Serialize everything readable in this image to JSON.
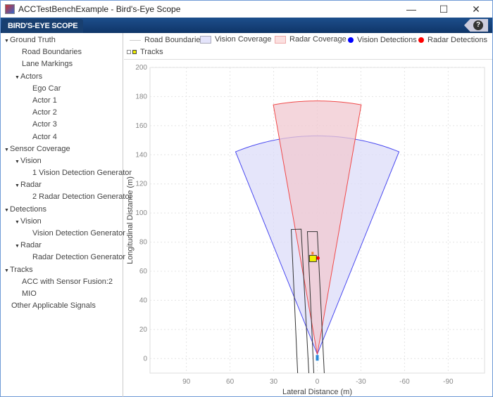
{
  "window": {
    "title": "ACCTestBenchExample - Bird's-Eye Scope",
    "minimize": "—",
    "maximize": "☐",
    "close": "✕"
  },
  "toolstrip": {
    "tab": "BIRD'S-EYE SCOPE",
    "help": "?"
  },
  "tree": [
    {
      "label": "Ground Truth",
      "level": 0,
      "expanded": true
    },
    {
      "label": "Road Boundaries",
      "level": 2
    },
    {
      "label": "Lane Markings",
      "level": 2
    },
    {
      "label": "Actors",
      "level": 1,
      "expanded": true
    },
    {
      "label": "Ego Car",
      "level": 3
    },
    {
      "label": "Actor 1",
      "level": 3
    },
    {
      "label": "Actor 2",
      "level": 3
    },
    {
      "label": "Actor 3",
      "level": 3
    },
    {
      "label": "Actor 4",
      "level": 3
    },
    {
      "label": "Sensor Coverage",
      "level": 0,
      "expanded": true
    },
    {
      "label": "Vision",
      "level": 1,
      "expanded": true
    },
    {
      "label": "1 Vision Detection Generator",
      "level": 3
    },
    {
      "label": "Radar",
      "level": 1,
      "expanded": true
    },
    {
      "label": "2 Radar Detection Generator",
      "level": 3
    },
    {
      "label": "Detections",
      "level": 0,
      "expanded": true
    },
    {
      "label": "Vision",
      "level": 1,
      "expanded": true
    },
    {
      "label": "Vision Detection Generator",
      "level": 3
    },
    {
      "label": "Radar",
      "level": 1,
      "expanded": true
    },
    {
      "label": "Radar Detection Generator",
      "level": 3
    },
    {
      "label": "Tracks",
      "level": 0,
      "expanded": true
    },
    {
      "label": "ACC with Sensor Fusion:2",
      "level": 2
    },
    {
      "label": "MIO",
      "level": 2
    },
    {
      "label": "Other Applicable Signals",
      "level": 1
    }
  ],
  "legend": {
    "road_boundaries": "Road Boundaries",
    "vision_coverage": "Vision Coverage",
    "radar_coverage": "Radar Coverage",
    "vision_detections": "Vision Detections",
    "radar_detections": "Radar Detections",
    "tracks": "Tracks"
  },
  "colors": {
    "vision": "#4a4af0",
    "vision_fill": "#dcdcf8",
    "radar": "#f04a4a",
    "radar_fill": "#f0c8d0",
    "road": "#333333",
    "ego": "#2a8ad8",
    "track": "#f0f000"
  },
  "chart_data": {
    "type": "scatter",
    "xlabel": "Lateral Distance (m)",
    "ylabel": "Longitudinal Distance (m)",
    "xlim": [
      115,
      -115
    ],
    "ylim": [
      -10,
      200
    ],
    "xticks": [
      90,
      60,
      30,
      0,
      -30,
      -60,
      -90
    ],
    "yticks": [
      0,
      20,
      40,
      60,
      80,
      100,
      120,
      140,
      160,
      180,
      200
    ],
    "grid": true,
    "sensor_origin": [
      0,
      3
    ],
    "vision_coverage": {
      "range": 150,
      "fov_deg": 44
    },
    "radar_coverage": {
      "range": 174,
      "fov_deg": 20
    },
    "road_boundaries": [
      [
        [
          17.9,
          88.7
        ],
        [
          13.5,
          -10
        ]
      ],
      [
        [
          11.1,
          88.9
        ],
        [
          5.8,
          -10
        ]
      ],
      [
        [
          6.8,
          87.2
        ],
        [
          2.4,
          -10
        ]
      ],
      [
        [
          0,
          87.2
        ],
        [
          -4.8,
          -10
        ]
      ]
    ],
    "ego_car": [
      0,
      0
    ],
    "tracks": [
      [
        3,
        68
      ]
    ],
    "radar_detections": [
      [
        1,
        70
      ]
    ]
  }
}
